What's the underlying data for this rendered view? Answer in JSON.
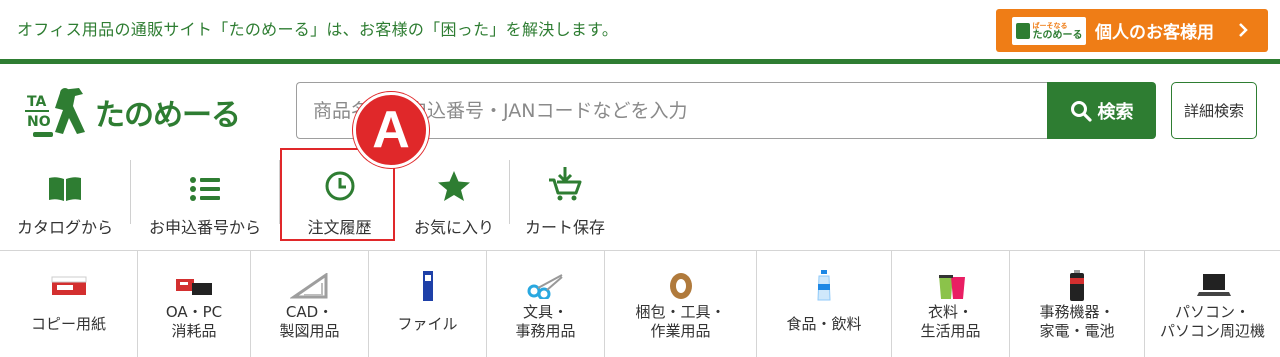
{
  "header": {
    "tagline": "オフィス用品の通販サイト「たのめーる」は、お客様の「困った」を解決します。",
    "personal_button": {
      "logo_top": "ぱーそなる",
      "logo_bottom": "たのめーる",
      "label": "個人のお客様用"
    }
  },
  "logo": {
    "text": "たのめーる",
    "letters": "TANO"
  },
  "search": {
    "placeholder": "商品名・お申込番号・JANコードなどを入力",
    "button_label": "検索",
    "detail_label": "詳細検索"
  },
  "quick_nav": [
    {
      "label": "カタログから",
      "icon": "book-icon"
    },
    {
      "label": "お申込番号から",
      "icon": "list-icon"
    },
    {
      "label": "注文履歴",
      "icon": "clock-icon"
    },
    {
      "label": "お気に入り",
      "icon": "star-icon"
    },
    {
      "label": "カート保存",
      "icon": "cart-download-icon"
    }
  ],
  "annotation": {
    "badge": "A",
    "color": "#e0282a"
  },
  "categories": [
    {
      "label": "コピー用紙"
    },
    {
      "label": "OA・PC\n消耗品"
    },
    {
      "label": "CAD・\n製図用品"
    },
    {
      "label": "ファイル"
    },
    {
      "label": "文具・\n事務用品"
    },
    {
      "label": "梱包・工具・\n作業用品"
    },
    {
      "label": "食品・飲料"
    },
    {
      "label": "衣料・\n生活用品"
    },
    {
      "label": "事務機器・\n家電・電池"
    },
    {
      "label": "パソコン・\nパソコン周辺機"
    }
  ],
  "colors": {
    "brand_green": "#2e7d32",
    "orange": "#ef7d16",
    "highlight_red": "#e0282a"
  }
}
